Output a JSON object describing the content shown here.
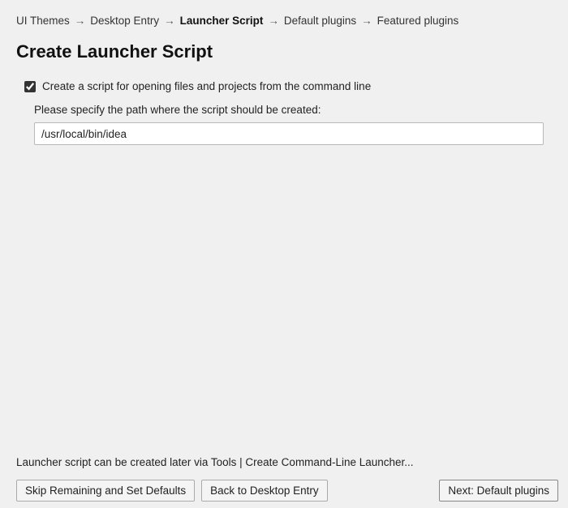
{
  "breadcrumb": {
    "items": [
      {
        "label": "UI Themes",
        "current": false
      },
      {
        "label": "Desktop Entry",
        "current": false
      },
      {
        "label": "Launcher Script",
        "current": true
      },
      {
        "label": "Default plugins",
        "current": false
      },
      {
        "label": "Featured plugins",
        "current": false
      }
    ],
    "separator": "→"
  },
  "title": "Create Launcher Script",
  "checkbox": {
    "checked": true,
    "label": "Create a script for opening files and projects from the command line"
  },
  "pathPrompt": "Please specify the path where the script should be created:",
  "pathValue": "/usr/local/bin/idea",
  "hint": "Launcher script can be created later via Tools | Create Command-Line Launcher...",
  "buttons": {
    "skip": "Skip Remaining and Set Defaults",
    "back": "Back to Desktop Entry",
    "next": "Next: Default plugins"
  }
}
